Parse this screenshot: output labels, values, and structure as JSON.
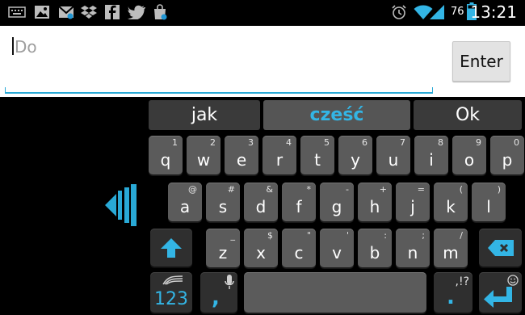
{
  "status_bar": {
    "time": "13:21",
    "battery": "76",
    "left_icons": [
      "keyboard-icon",
      "image-icon",
      "gmail-icon",
      "dropbox-icon",
      "facebook-icon",
      "twitter-icon",
      "shopping-bag-icon"
    ],
    "right_icons": [
      "alarm-icon",
      "wifi-icon",
      "signal-icon",
      "battery-icon"
    ]
  },
  "compose": {
    "field_placeholder": "Do",
    "enter_label": "Enter"
  },
  "suggestions": [
    "jak",
    "cześć",
    "Ok"
  ],
  "keyboard": {
    "row1": [
      {
        "main": "q",
        "hint": "1"
      },
      {
        "main": "w",
        "hint": "2"
      },
      {
        "main": "e",
        "hint": "3"
      },
      {
        "main": "r",
        "hint": "4"
      },
      {
        "main": "t",
        "hint": "5"
      },
      {
        "main": "y",
        "hint": "6"
      },
      {
        "main": "u",
        "hint": "7"
      },
      {
        "main": "i",
        "hint": "8"
      },
      {
        "main": "o",
        "hint": "9"
      },
      {
        "main": "p",
        "hint": "0"
      }
    ],
    "row2": [
      {
        "main": "a",
        "hint": "@"
      },
      {
        "main": "s",
        "hint": "#"
      },
      {
        "main": "d",
        "hint": "&"
      },
      {
        "main": "f",
        "hint": "*"
      },
      {
        "main": "g",
        "hint": "-"
      },
      {
        "main": "h",
        "hint": "+"
      },
      {
        "main": "j",
        "hint": "="
      },
      {
        "main": "k",
        "hint": "("
      },
      {
        "main": "l",
        "hint": ")"
      }
    ],
    "row3": [
      {
        "main": "z",
        "hint": "_"
      },
      {
        "main": "x",
        "hint": "$"
      },
      {
        "main": "c",
        "hint": "\""
      },
      {
        "main": "v",
        "hint": "'"
      },
      {
        "main": "b",
        "hint": ":"
      },
      {
        "main": "n",
        "hint": ";"
      },
      {
        "main": "m",
        "hint": "/"
      }
    ],
    "numbers_label": "123",
    "comma_label": ",",
    "period_label": ".",
    "period_hint": ",!?",
    "accent_color": "#33b5e5"
  }
}
